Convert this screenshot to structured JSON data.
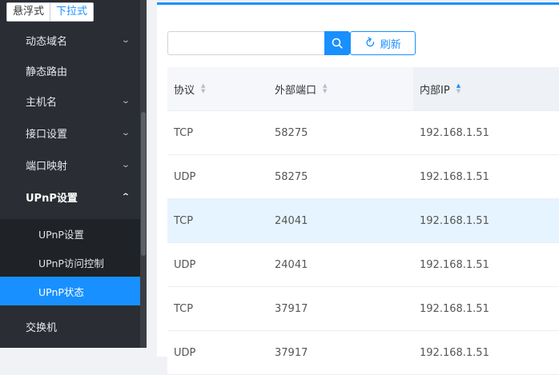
{
  "mode_toggle": {
    "floating": "悬浮式",
    "dropdown": "下拉式"
  },
  "sidebar": {
    "items": [
      {
        "label": "动态域名",
        "chevron": "down"
      },
      {
        "label": "静态路由",
        "chevron": ""
      },
      {
        "label": "主机名",
        "chevron": "down"
      },
      {
        "label": "接口设置",
        "chevron": "down"
      },
      {
        "label": "端口映射",
        "chevron": "down"
      },
      {
        "label": "UPnP设置",
        "chevron": "up"
      },
      {
        "label": "交换机",
        "chevron": ""
      }
    ],
    "subitems": [
      {
        "label": "UPnP设置"
      },
      {
        "label": "UPnP访问控制"
      },
      {
        "label": "UPnP状态"
      }
    ]
  },
  "search": {
    "placeholder": "",
    "icon": "search-icon"
  },
  "refresh": {
    "label": "刷新",
    "icon": "refresh-icon"
  },
  "colors": {
    "accent": "#1890ff",
    "sidebar_bg": "#2a2d33",
    "row_hover": "#e6f4ff"
  },
  "table": {
    "headers": {
      "protocol": "协议",
      "external_port": "外部端口",
      "internal_ip": "内部IP"
    },
    "sort": {
      "internal_ip": "ascending"
    },
    "rows": [
      {
        "protocol": "TCP",
        "port": "58275",
        "ip": "192.168.1.51"
      },
      {
        "protocol": "UDP",
        "port": "58275",
        "ip": "192.168.1.51"
      },
      {
        "protocol": "TCP",
        "port": "24041",
        "ip": "192.168.1.51"
      },
      {
        "protocol": "UDP",
        "port": "24041",
        "ip": "192.168.1.51"
      },
      {
        "protocol": "TCP",
        "port": "37917",
        "ip": "192.168.1.51"
      },
      {
        "protocol": "UDP",
        "port": "37917",
        "ip": "192.168.1.51"
      }
    ]
  }
}
